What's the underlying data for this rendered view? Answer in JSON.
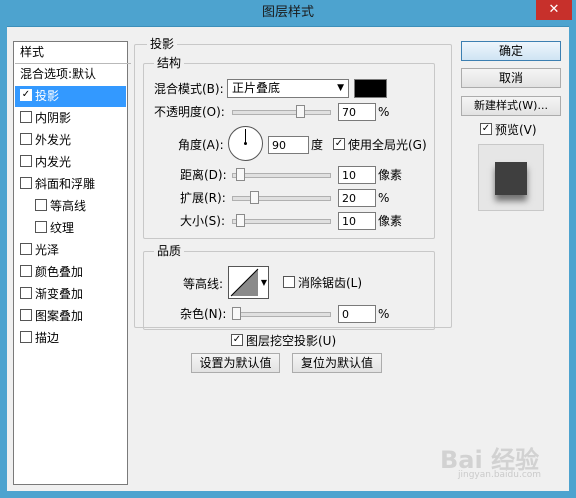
{
  "window": {
    "title": "图层样式",
    "close_label": "✕"
  },
  "styles_list": {
    "header": "样式",
    "items": [
      {
        "label": "混合选项:默认",
        "checkbox": false,
        "checked": false,
        "selected": false,
        "indent": false
      },
      {
        "label": "投影",
        "checkbox": true,
        "checked": true,
        "selected": true,
        "indent": false
      },
      {
        "label": "内阴影",
        "checkbox": true,
        "checked": false,
        "selected": false,
        "indent": false
      },
      {
        "label": "外发光",
        "checkbox": true,
        "checked": false,
        "selected": false,
        "indent": false
      },
      {
        "label": "内发光",
        "checkbox": true,
        "checked": false,
        "selected": false,
        "indent": false
      },
      {
        "label": "斜面和浮雕",
        "checkbox": true,
        "checked": false,
        "selected": false,
        "indent": false
      },
      {
        "label": "等高线",
        "checkbox": true,
        "checked": false,
        "selected": false,
        "indent": true
      },
      {
        "label": "纹理",
        "checkbox": true,
        "checked": false,
        "selected": false,
        "indent": true
      },
      {
        "label": "光泽",
        "checkbox": true,
        "checked": false,
        "selected": false,
        "indent": false
      },
      {
        "label": "颜色叠加",
        "checkbox": true,
        "checked": false,
        "selected": false,
        "indent": false
      },
      {
        "label": "渐变叠加",
        "checkbox": true,
        "checked": false,
        "selected": false,
        "indent": false
      },
      {
        "label": "图案叠加",
        "checkbox": true,
        "checked": false,
        "selected": false,
        "indent": false
      },
      {
        "label": "描边",
        "checkbox": true,
        "checked": false,
        "selected": false,
        "indent": false
      }
    ]
  },
  "drop_shadow": {
    "title": "投影",
    "structure": {
      "title": "结构",
      "blend_mode_label": "混合模式(B):",
      "blend_mode_value": "正片叠底",
      "blend_color": "#000000",
      "opacity_label": "不透明度(O):",
      "opacity_value": "70",
      "opacity_fraction": 0.7,
      "percent": "%",
      "angle_label": "角度(A):",
      "angle_value": "90",
      "degree": "度",
      "global_light_label": "使用全局光(G)",
      "global_light_checked": true,
      "distance_label": "距离(D):",
      "distance_value": "10",
      "size_fraction_distance": 0.04,
      "pixels": "像素",
      "spread_label": "扩展(R):",
      "spread_value": "20",
      "spread_fraction": 0.2,
      "size_label": "大小(S):",
      "size_value": "10",
      "size_fraction": 0.04
    },
    "quality": {
      "title": "品质",
      "contour_label": "等高线:",
      "antialias_label": "消除锯齿(L)",
      "antialias_checked": false,
      "noise_label": "杂色(N):",
      "noise_value": "0",
      "noise_fraction": 0,
      "percent": "%"
    },
    "knockout_label": "图层挖空投影(U)",
    "knockout_checked": true,
    "make_default_label": "设置为默认值",
    "reset_default_label": "复位为默认值"
  },
  "buttons": {
    "ok": "确定",
    "cancel": "取消",
    "new_style": "新建样式(W)...",
    "preview_label": "预览(V)",
    "preview_checked": true
  },
  "watermark": {
    "text": "Bai 经验",
    "subtext": "jingyan.baidu.com"
  },
  "colors": {
    "titlebar": "#4da3cf",
    "selection": "#3399ff",
    "close": "#c7302b"
  }
}
